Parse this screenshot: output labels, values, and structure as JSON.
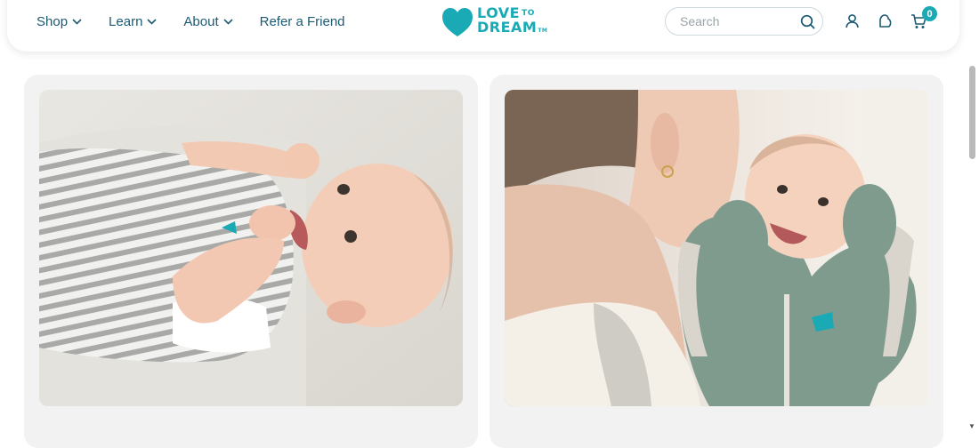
{
  "nav": {
    "items": [
      {
        "label": "Shop",
        "has_dropdown": true
      },
      {
        "label": "Learn",
        "has_dropdown": true
      },
      {
        "label": "About",
        "has_dropdown": true
      },
      {
        "label": "Refer a Friend",
        "has_dropdown": false
      }
    ]
  },
  "logo": {
    "line1": "LOVE",
    "to": "TO",
    "line2": "DREAM",
    "tm": "TM",
    "color": "#19aab5"
  },
  "search": {
    "placeholder": "Search",
    "icon": "search-icon"
  },
  "header_icons": [
    "account-icon",
    "sleep-bag-icon",
    "cart-icon"
  ],
  "cart": {
    "count": "0"
  },
  "cards": [
    {
      "image": "baby-lying-in-striped-sleep-suit"
    },
    {
      "image": "mother-holding-baby-in-green-swaddle"
    }
  ],
  "colors": {
    "brand": "#19aab5",
    "nav_text": "#1c5a73",
    "card_bg": "#f2f2f2"
  }
}
